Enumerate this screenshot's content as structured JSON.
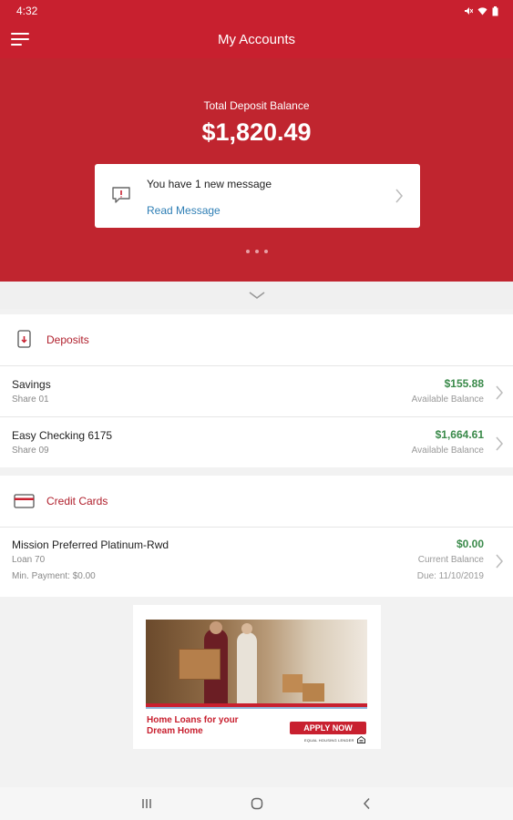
{
  "status_bar": {
    "time": "4:32",
    "icons": [
      "mute-icon",
      "wifi-icon",
      "battery-icon"
    ]
  },
  "app_bar": {
    "title": "My Accounts"
  },
  "hero": {
    "label": "Total Deposit Balance",
    "amount": "$1,820.49",
    "message": {
      "title": "You have 1 new message",
      "link": "Read Message"
    }
  },
  "deposits": {
    "title": "Deposits",
    "accounts": [
      {
        "name": "Savings",
        "share": "Share 01",
        "amount": "$155.88",
        "amount_label": "Available Balance"
      },
      {
        "name": "Easy Checking 6175",
        "share": "Share 09",
        "amount": "$1,664.61",
        "amount_label": "Available Balance"
      }
    ]
  },
  "credit_cards": {
    "title": "Credit Cards",
    "accounts": [
      {
        "name": "Mission Preferred Platinum-Rwd",
        "loan": "Loan 70",
        "min_payment": "Min. Payment: $0.00",
        "amount": "$0.00",
        "amount_label": "Current Balance",
        "due": "Due: 11/10/2019"
      }
    ]
  },
  "ad": {
    "headline": "Home Loans for your Dream Home",
    "cta": "APPLY NOW",
    "fine_print": "EQUAL HOUSING LENDER"
  },
  "colors": {
    "brand": "#c8202f",
    "positive": "#3a8a4a",
    "link": "#2f7fb5"
  }
}
